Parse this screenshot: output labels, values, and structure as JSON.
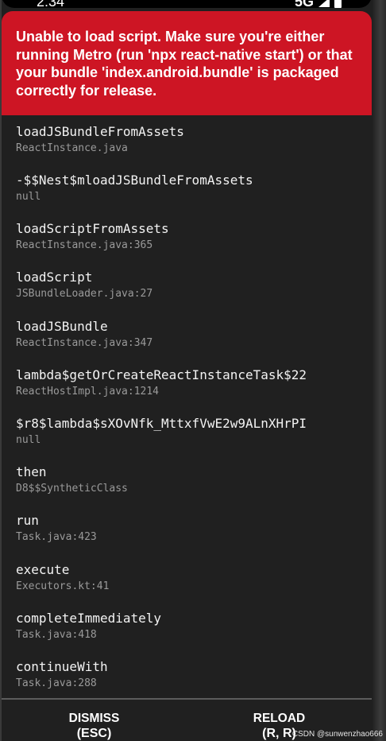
{
  "status_bar": {
    "time": "2:34",
    "network": "5G"
  },
  "error": {
    "message": "Unable to load script. Make sure you're either running Metro (run 'npx react-native start') or that your bundle 'index.android.bundle' is packaged correctly for release."
  },
  "stack": [
    {
      "method": "loadJSBundleFromAssets",
      "file": "ReactInstance.java"
    },
    {
      "method": "-$$Nest$mloadJSBundleFromAssets",
      "file": "null"
    },
    {
      "method": "loadScriptFromAssets",
      "file": "ReactInstance.java:365"
    },
    {
      "method": "loadScript",
      "file": "JSBundleLoader.java:27"
    },
    {
      "method": "loadJSBundle",
      "file": "ReactInstance.java:347"
    },
    {
      "method": "lambda$getOrCreateReactInstanceTask$22",
      "file": "ReactHostImpl.java:1214"
    },
    {
      "method": "$r8$lambda$sXOvNfk_MttxfVwE2w9ALnXHrPI",
      "file": "null"
    },
    {
      "method": "then",
      "file": "D8$$SyntheticClass"
    },
    {
      "method": "run",
      "file": "Task.java:423"
    },
    {
      "method": "execute",
      "file": "Executors.kt:41"
    },
    {
      "method": "completeImmediately",
      "file": "Task.java:418"
    },
    {
      "method": "continueWith",
      "file": "Task.java:288"
    }
  ],
  "footer": {
    "dismiss_label": "DISMISS",
    "dismiss_shortcut": "(ESC)",
    "reload_label": "RELOAD",
    "reload_shortcut": "(R, R)"
  },
  "watermark": "CSDN @sunwenzhao666",
  "colors": {
    "error_red": "#cd1524",
    "background": "#202020"
  }
}
